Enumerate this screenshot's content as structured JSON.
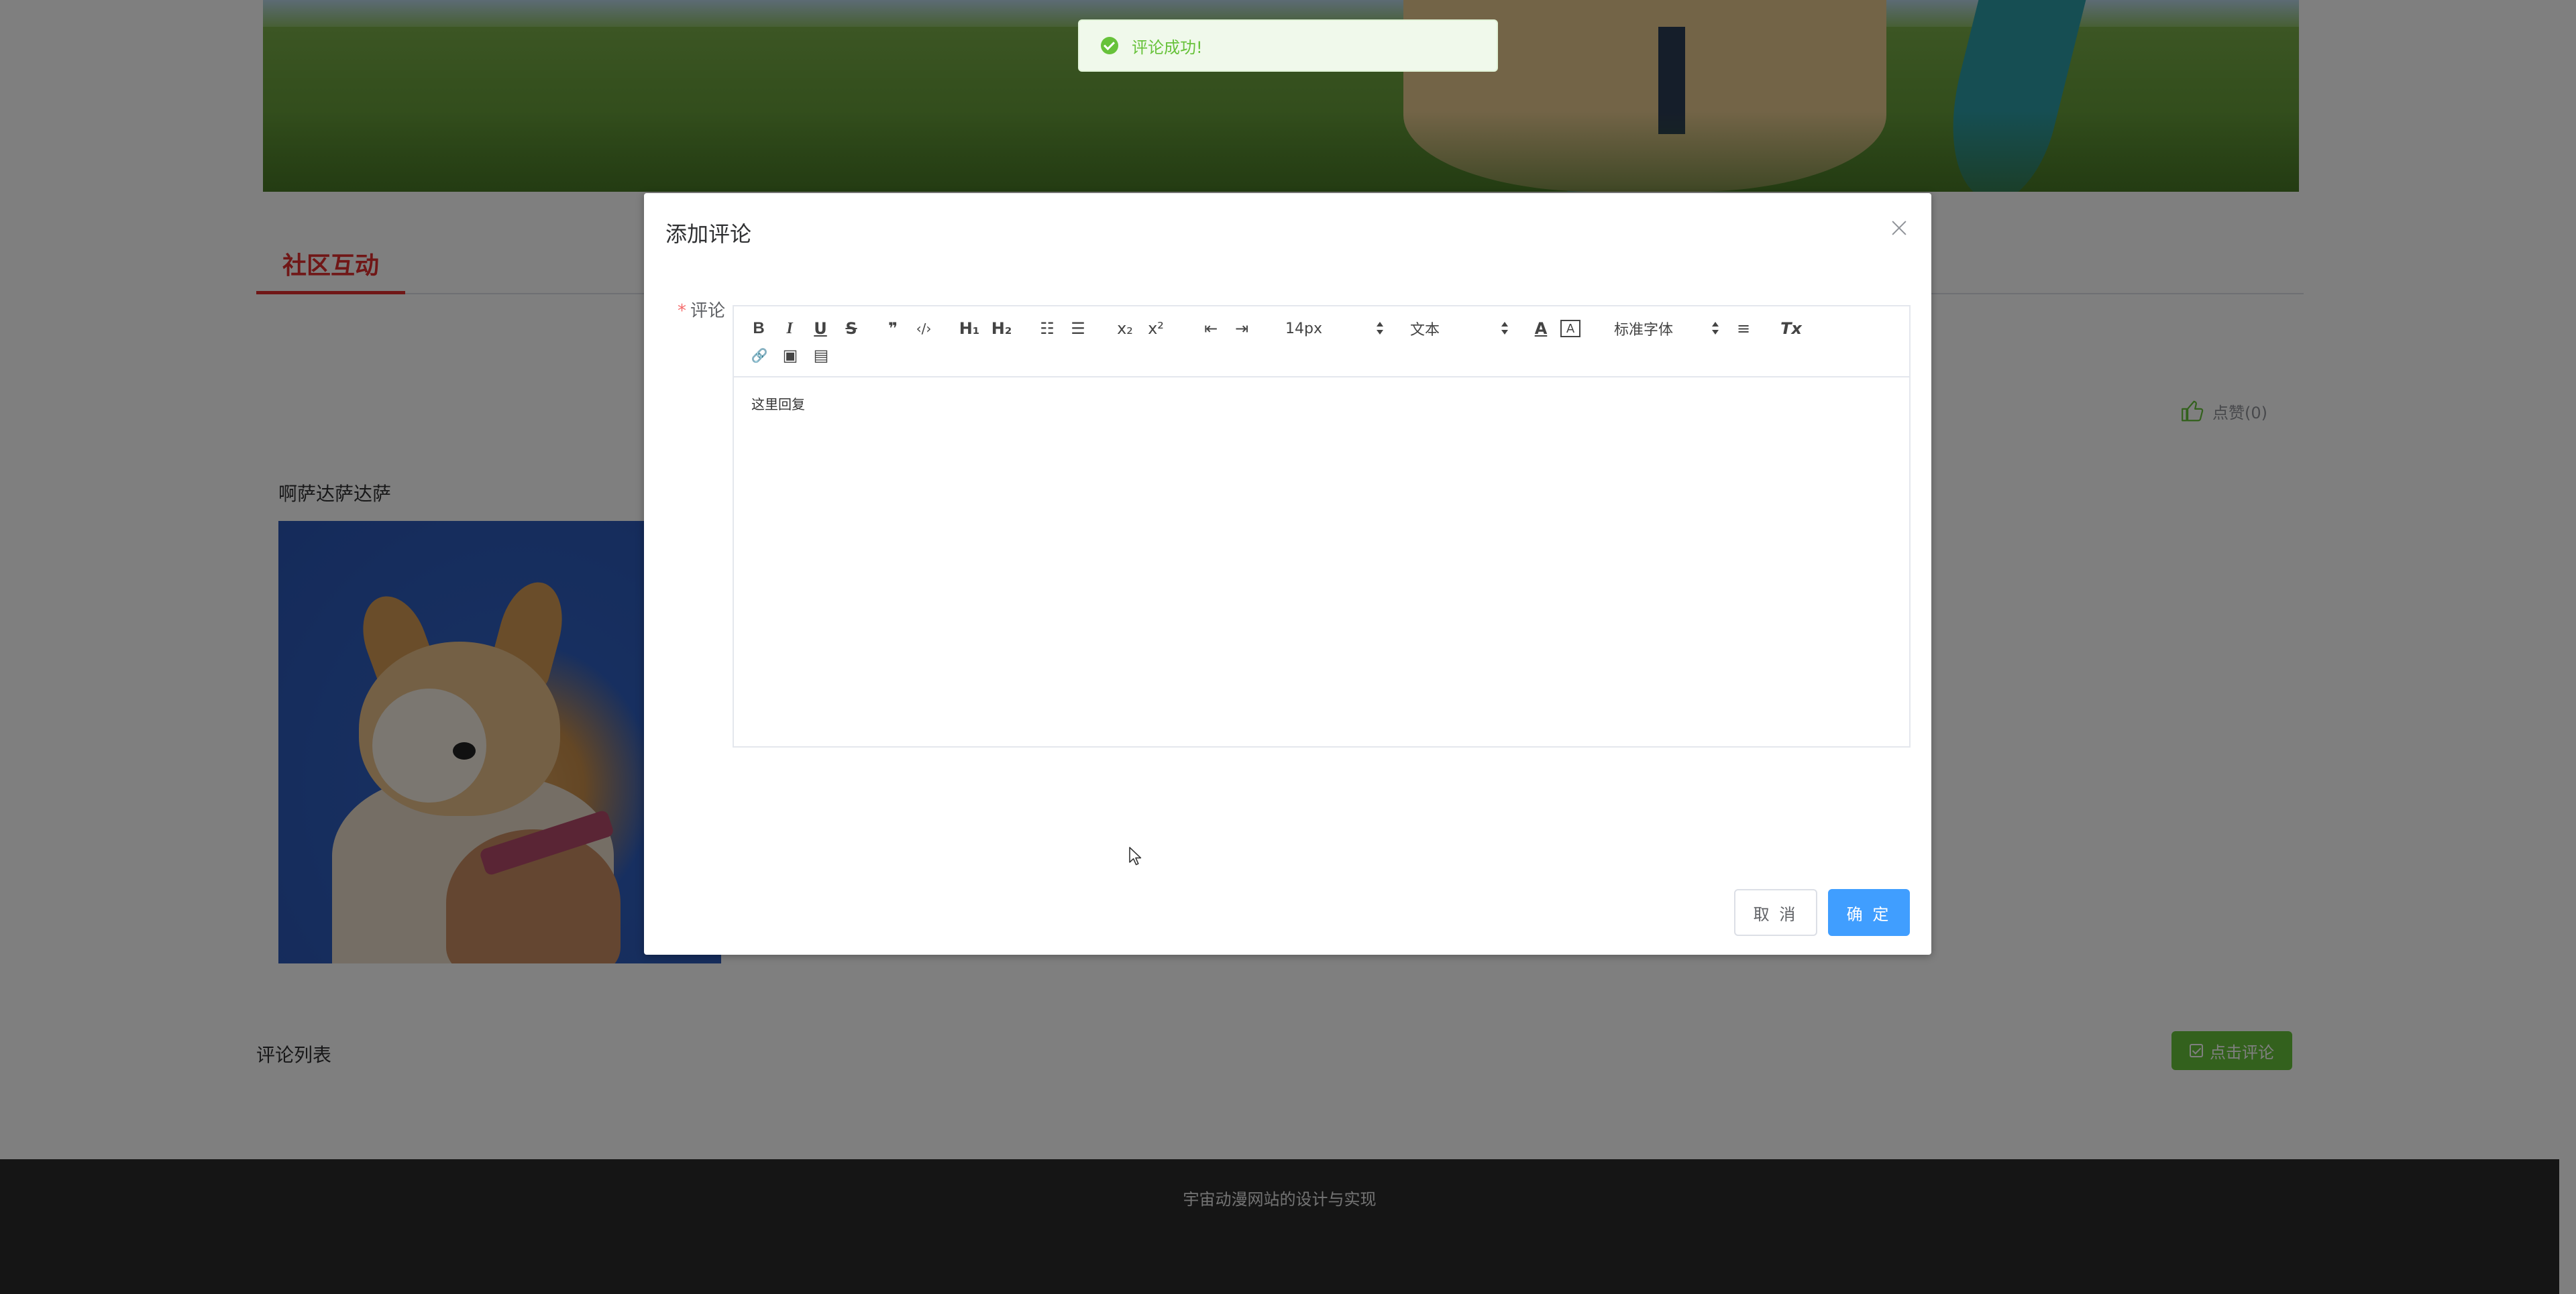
{
  "page": {
    "section_tab": "社区互动",
    "like_label": "点赞(0)",
    "post_title": "啊萨达萨达萨",
    "comment_list_title": "评论列表",
    "comment_button_label": "点击评论",
    "footer_text": "宇宙动漫网站的设计与实现"
  },
  "dialog": {
    "title": "添加评论",
    "field_label": "评论",
    "required_mark": "*",
    "editor_content": "这里回复",
    "toolbar": {
      "bold": "B",
      "italic": "I",
      "underline": "U",
      "strike": "S",
      "blockquote": "❞",
      "code": "‹/›",
      "h1": "H₁",
      "h2": "H₂",
      "ordered_list": "☷",
      "bullet_list": "☰",
      "subscript": "x₂",
      "superscript": "x²",
      "outdent": "⇤",
      "indent": "⇥",
      "size_value": "14px",
      "header_value": "文本",
      "font_value": "标准字体",
      "text_color": "A",
      "background_color": "A",
      "align": "≡",
      "clean": "Tx",
      "link": "🔗",
      "image": "▣",
      "video": "▤"
    },
    "cancel_label": "取 消",
    "ok_label": "确 定"
  },
  "toast": {
    "message": "评论成功!"
  },
  "colors": {
    "accent_red": "#e12f2f",
    "primary_blue": "#409eff",
    "success_green": "#67c23a",
    "footer_bg": "#2b2b2b"
  }
}
